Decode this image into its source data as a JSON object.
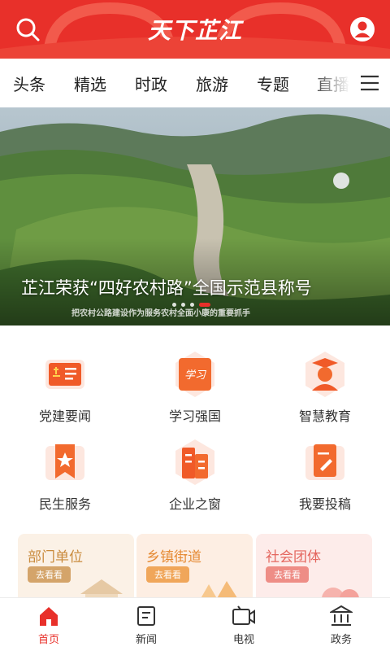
{
  "header": {
    "logo_text": "天下芷江",
    "search_icon": "search-icon",
    "user_icon": "user-icon",
    "bg_color": "#e8302a"
  },
  "tabs": {
    "items": [
      "头条",
      "精选",
      "时政",
      "旅游",
      "专题",
      "直播"
    ],
    "menu_icon": "menu-icon"
  },
  "banner": {
    "headline": "芷江荣获“四好农村路”全国示范县称号",
    "caption": "把农村公路建设作为服务农村全面小康的重要抓手",
    "active_index": 3,
    "dot_count": 4
  },
  "services": [
    {
      "label": "党建要闻",
      "icon": "party-news-icon"
    },
    {
      "label": "学习强国",
      "icon": "study-icon"
    },
    {
      "label": "智慧教育",
      "icon": "education-icon"
    },
    {
      "label": "民生服务",
      "icon": "livelihood-icon"
    },
    {
      "label": "企业之窗",
      "icon": "enterprise-icon"
    },
    {
      "label": "我要投稿",
      "icon": "submit-icon"
    }
  ],
  "cards": [
    {
      "title": "部门单位",
      "button": "去看看",
      "color": "#d99b4a"
    },
    {
      "title": "乡镇街道",
      "button": "去看看",
      "color": "#e89a3c"
    },
    {
      "title": "社会团体",
      "button": "去看看",
      "color": "#e8716a"
    }
  ],
  "bottom_nav": {
    "items": [
      {
        "label": "首页",
        "icon": "home-icon",
        "active": true
      },
      {
        "label": "新闻",
        "icon": "news-icon",
        "active": false
      },
      {
        "label": "电视",
        "icon": "tv-icon",
        "active": false
      },
      {
        "label": "政务",
        "icon": "government-icon",
        "active": false
      }
    ]
  },
  "colors": {
    "accent": "#e8302a",
    "icon_orange": "#f26a2e"
  }
}
